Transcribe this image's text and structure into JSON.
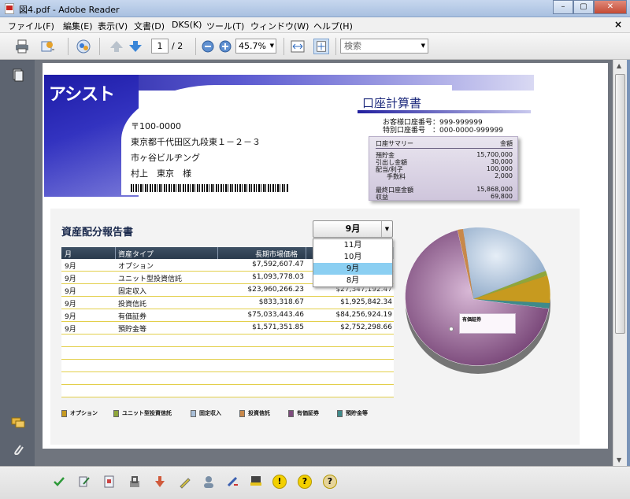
{
  "window": {
    "title": "図4.pdf - Adobe Reader",
    "min": "–",
    "max": "▢",
    "close": "✕"
  },
  "menu": [
    "ファイル(F)",
    "編集(E)",
    "表示(V)",
    "文書(D)",
    "DKS(K)",
    "ツール(T)",
    "ウィンドウ(W)",
    "ヘルプ(H)"
  ],
  "menu_close": "×",
  "toolbar": {
    "page_current": "1",
    "page_total": "/ 2",
    "zoom": "45.7%",
    "search_placeholder": "検索"
  },
  "doc": {
    "logo": "アシスト",
    "address": {
      "zip": "〒100-0000",
      "line1": "東京都千代田区九段東１－２－３",
      "line2": "市ヶ谷ビルヂング",
      "name": "村上　東京　様"
    },
    "account": {
      "title": "口座計算書",
      "no1": "お客様口座番号：999-999999",
      "no2": "特別口座番号　：000-0000-999999",
      "summary_header": "口座サマリー",
      "summary_amount_header": "金額",
      "rows": [
        {
          "label": "預貯金",
          "value": "15,700,000"
        },
        {
          "label": "引出し金額",
          "value": "30,000"
        },
        {
          "label": "配当/利子",
          "value": "100,000"
        },
        {
          "label": "手数料",
          "value": "2,000"
        }
      ],
      "final_label": "最終口座金額",
      "final_value": "15,868,000",
      "income_label": "収益",
      "income_value": "69,800"
    },
    "report": {
      "title": "資産配分報告書",
      "selected_month": "9月",
      "dropdown_options": [
        "11月",
        "10月",
        "9月",
        "8月"
      ],
      "columns": [
        "月",
        "資産タイプ",
        "長期市場価格",
        ""
      ],
      "rows": [
        {
          "month": "9月",
          "type": "オプション",
          "long": "$7,592,607.47",
          "current": ""
        },
        {
          "month": "9月",
          "type": "ユニット型投資信託",
          "long": "$1,093,778.03",
          "current": ""
        },
        {
          "month": "9月",
          "type": "固定収入",
          "long": "$23,960,266.23",
          "current": "$27,347,192.47"
        },
        {
          "month": "9月",
          "type": "投資信託",
          "long": "$833,318.67",
          "current": "$1,925,842.34"
        },
        {
          "month": "9月",
          "type": "有価証券",
          "long": "$75,033,443.46",
          "current": "$84,256,924.19"
        },
        {
          "month": "9月",
          "type": "預貯金等",
          "long": "$1,571,351.85",
          "current": "$2,752,298.66"
        }
      ],
      "legend": [
        {
          "label": "オプション",
          "color": "#c79a1f"
        },
        {
          "label": "ユニット型投資信託",
          "color": "#8fa63a"
        },
        {
          "label": "固定収入",
          "color": "#a9bfd8"
        },
        {
          "label": "投資信託",
          "color": "#c8884a"
        },
        {
          "label": "有価証券",
          "color": "#7e4c7e"
        },
        {
          "label": "預貯金等",
          "color": "#3f8a8a"
        }
      ],
      "pie_label": "有価証券"
    }
  }
}
